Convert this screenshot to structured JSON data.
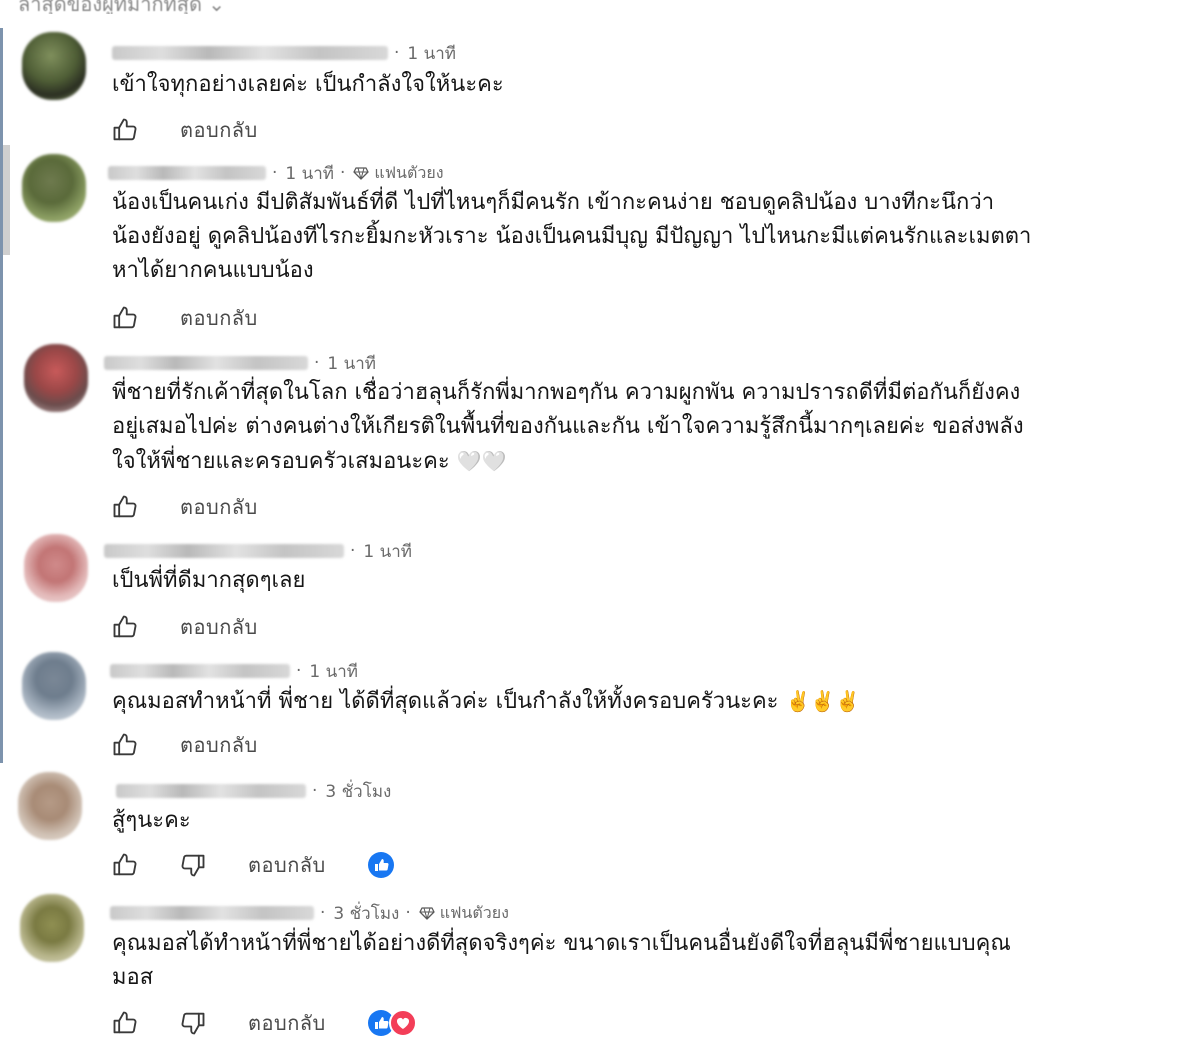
{
  "header": {
    "sort_label": "ล่าสุดของผู้ที่มากที่สุด ⌄"
  },
  "comments": [
    {
      "time": "1 นาที",
      "text": "เข้าใจทุกอย่างเลยค่ะ เป็นกำลังใจให้นะคะ",
      "reply": "ตอบกลับ"
    },
    {
      "time": "1 นาที",
      "badge": "แฟนตัวยง",
      "text": "น้องเป็นคนเก่ง มีปติสัมพันธ์ที่ดี ไปที่ไหนๆก็มีคนรัก เข้ากะคนง่าย ชอบดูคลิปน้อง บางทีกะนึกว่า\nน้องยังอยู่ ดูคลิปน้องทีไรกะยิ้มกะหัวเราะ น้องเป็นคนมีบุญ มีปัญญา ไปไหนกะมีแต่คนรักและเมตตา\nหาได้ยากคนแบบน้อง",
      "reply": "ตอบกลับ"
    },
    {
      "time": "1 นาที",
      "text": "พี่ชายที่รักเค้าที่สุดในโลก เชื่อว่าฮลุนก็รักพี่มากพอๆกัน ความผูกพัน ความปรารถดีที่มีต่อกันก็ยังคง\nอยู่เสมอไปค่ะ ต่างคนต่างให้เกียรติในพื้นที่ของกันและกัน เข้าใจความรู้สึกนี้มากๆเลยค่ะ ขอส่งพลัง\nใจให้พี่ชายและครอบครัวเสมอนะคะ",
      "emoji": "🤍🤍",
      "reply": "ตอบกลับ"
    },
    {
      "time": "1 นาที",
      "text": "เป็นพี่ที่ดีมากสุดๆเลย",
      "reply": "ตอบกลับ"
    },
    {
      "time": "1 นาที",
      "text": "คุณมอสทำหน้าที่ พี่ชาย ได้ดีที่สุดแล้วค่ะ เป็นกำลังให้ทั้งครอบครัวนะคะ",
      "emoji": "✌️✌️✌️",
      "reply": "ตอบกลับ"
    },
    {
      "time": "3 ชั่วโมง",
      "text": "สู้ๆนะคะ",
      "reply": "ตอบกลับ"
    },
    {
      "time": "3 ชั่วโมง",
      "badge": "แฟนตัวยง",
      "text": "คุณมอสได้ทำหน้าที่พี่ชายได้อย่างดีที่สุดจริงๆค่ะ ขนาดเราเป็นคนอื่นยังดีใจที่ฮลุนมีพี่ชายแบบคุณ\nมอส",
      "reply": "ตอบกลับ"
    }
  ],
  "icons": [
    "like-icon",
    "dislike-icon",
    "diamond-icon",
    "like-reaction-icon",
    "love-reaction-icon"
  ],
  "colors": {
    "accent_blue": "#1877f2",
    "love_red": "#f33e58",
    "rule_blue": "#7d93ad"
  }
}
